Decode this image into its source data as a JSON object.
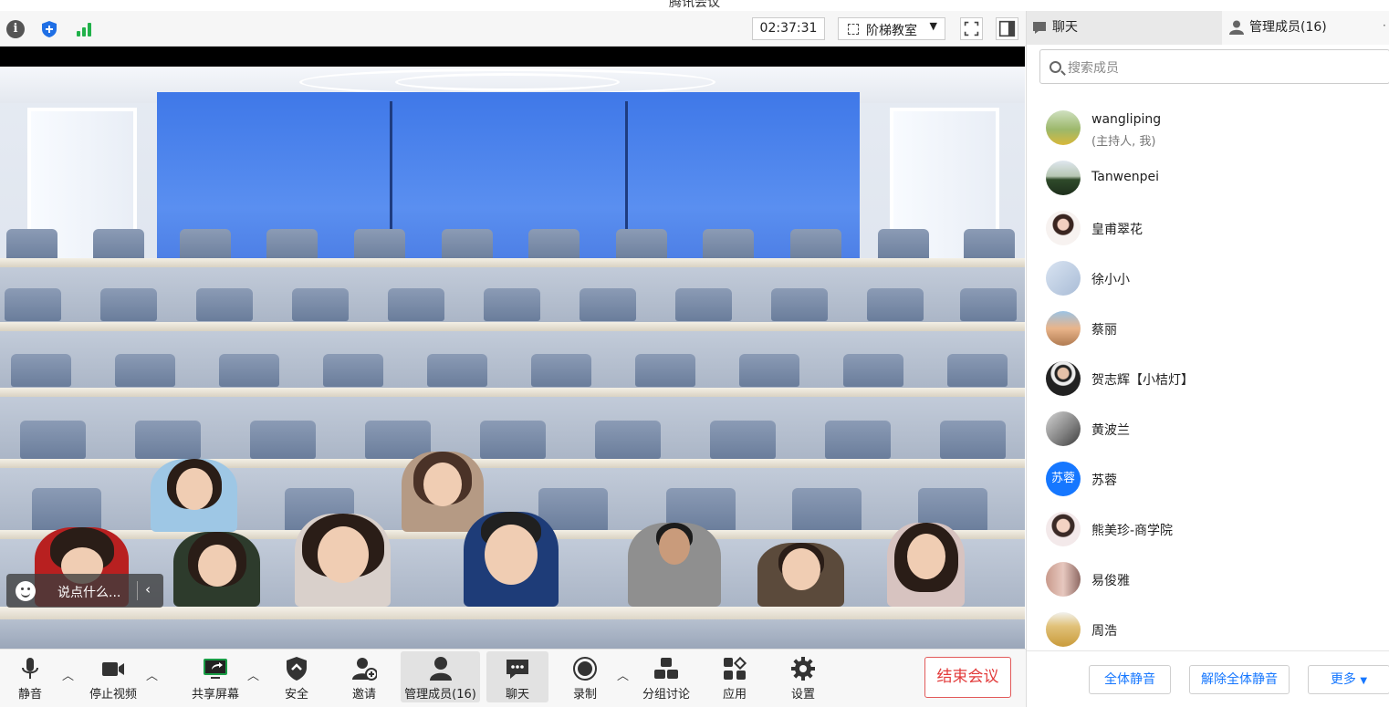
{
  "window": {
    "title": "腾讯会议"
  },
  "toolbar": {
    "timer": "02:37:31",
    "scene_label": "阶梯教室",
    "info_glyph": "i"
  },
  "chat_input": {
    "placeholder": "说点什么..."
  },
  "bottom_bar": {
    "mute": "静音",
    "stop_video": "停止视频",
    "share_screen": "共享屏幕",
    "security": "安全",
    "invite": "邀请",
    "manage_members": "管理成员(16)",
    "chat": "聊天",
    "record": "录制",
    "breakout": "分组讨论",
    "apps": "应用",
    "settings": "设置",
    "end_meeting": "结束会议"
  },
  "panel": {
    "tab_chat": "聊天",
    "tab_members": "管理成员(16)",
    "search_placeholder": "搜索成员",
    "members": [
      {
        "name": "wangliping",
        "sub": "(主持人, 我)"
      },
      {
        "name": "Tanwenpei"
      },
      {
        "name": "皇甫翠花"
      },
      {
        "name": "徐小小"
      },
      {
        "name": "蔡丽"
      },
      {
        "name": "贺志辉【小桔灯】"
      },
      {
        "name": "黄波兰"
      },
      {
        "name": "苏蓉",
        "avatar_text": "苏蓉"
      },
      {
        "name": "熊美珍-商学院"
      },
      {
        "name": "易俊雅"
      },
      {
        "name": "周浩"
      }
    ],
    "mute_all": "全体静音",
    "unmute_all": "解除全体静音",
    "more": "更多"
  },
  "colors": {
    "accent": "#1677ff",
    "danger": "#e23b3b",
    "scene_blue": "#4a7fe8"
  }
}
